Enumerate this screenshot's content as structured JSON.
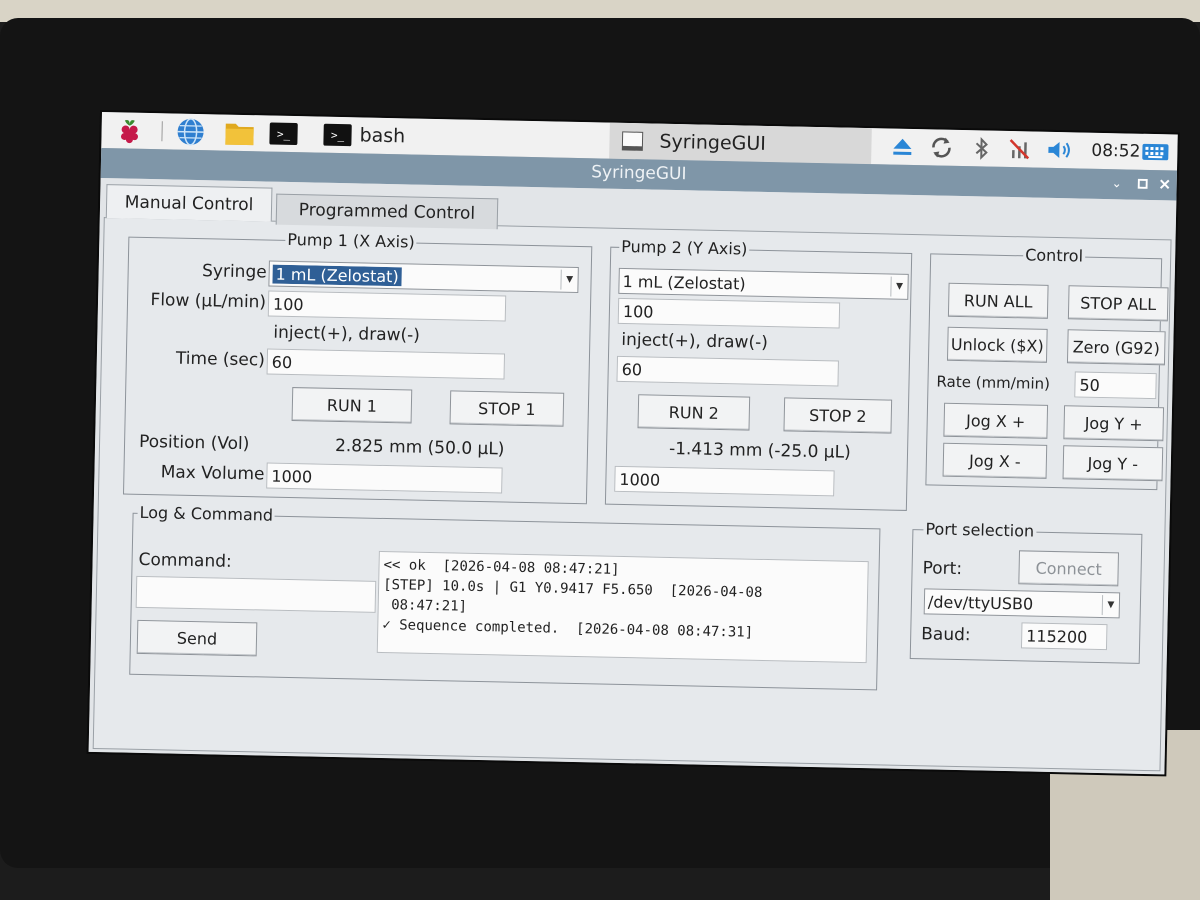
{
  "taskbar": {
    "terminal_icon_glyph": ">_",
    "bash_label": "bash",
    "window_button_label": "SyringeGUI",
    "clock": "08:52"
  },
  "window": {
    "title": "SyringeGUI"
  },
  "tabs": [
    {
      "label": "Manual Control",
      "active": true
    },
    {
      "label": "Programmed Control",
      "active": false
    }
  ],
  "pump1": {
    "title": "Pump 1 (X Axis)",
    "syringe_label": "Syringe",
    "syringe_value": "1 mL (Zelostat)",
    "flow_label": "Flow (µL/min)",
    "flow_value": "100",
    "hint": "inject(+), draw(-)",
    "time_label": "Time (sec)",
    "time_value": "60",
    "run_label": "RUN 1",
    "stop_label": "STOP 1",
    "position_label": "Position (Vol)",
    "position_value": "2.825 mm (50.0 µL)",
    "maxvol_label": "Max Volume",
    "maxvol_value": "1000"
  },
  "pump2": {
    "title": "Pump 2 (Y Axis)",
    "syringe_value": "1 mL (Zelostat)",
    "flow_value": "100",
    "hint": "inject(+), draw(-)",
    "time_value": "60",
    "run_label": "RUN 2",
    "stop_label": "STOP 2",
    "position_value": "-1.413 mm (-25.0 µL)",
    "maxvol_value": "1000"
  },
  "control": {
    "title": "Control",
    "run_all": "RUN ALL",
    "stop_all": "STOP ALL",
    "unlock": "Unlock ($X)",
    "zero": "Zero (G92)",
    "rate_label": "Rate (mm/min)",
    "rate_value": "50",
    "jog_x_plus": "Jog X +",
    "jog_y_plus": "Jog Y +",
    "jog_x_minus": "Jog X -",
    "jog_y_minus": "Jog Y -"
  },
  "log_command": {
    "title": "Log & Command",
    "command_label": "Command:",
    "command_value": "",
    "send_label": "Send",
    "log_lines": [
      "<< ok  [2026-04-08 08:47:21]",
      "[STEP] 10.0s | G1 Y0.9417 F5.650  [2026-04-08",
      " 08:47:21]",
      "✓ Sequence completed.  [2026-04-08 08:47:31]"
    ]
  },
  "port_selection": {
    "title": "Port selection",
    "port_label": "Port:",
    "connect_label": "Connect",
    "port_value": "/dev/ttyUSB0",
    "baud_label": "Baud:",
    "baud_value": "115200"
  },
  "colors": {
    "titlebar": "#7f96a8",
    "selection": "#2f5f96",
    "raspberry": "#c51a4a"
  }
}
